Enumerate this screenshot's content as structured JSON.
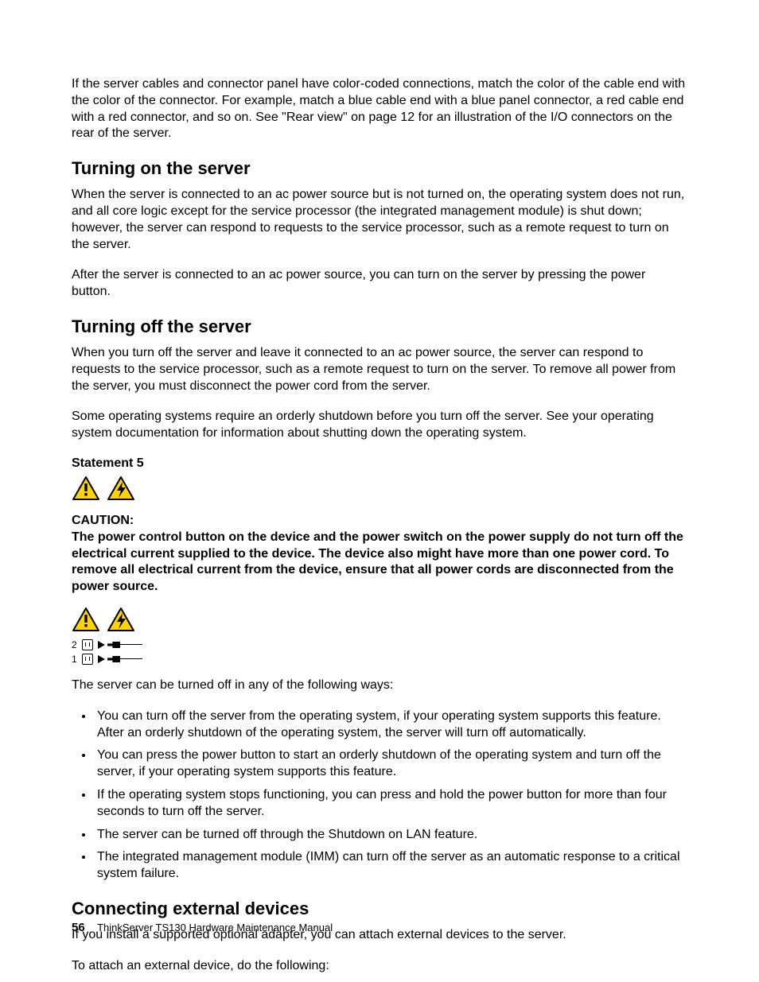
{
  "intro": "If the server cables and connector panel have color-coded connections, match the color of the cable end with the color of the connector. For example, match a blue cable end with a blue panel connector, a red cable end with a red connector, and so on. See \"Rear view\" on page 12 for an illustration of the I/O connectors on the rear of the server.",
  "section1": {
    "title": "Turning on the server",
    "p1": "When the server is connected to an ac power source but is not turned on, the operating system does not run, and all core logic except for the service processor (the integrated management module) is shut down; however, the server can respond to requests to the service processor, such as a remote request to turn on the server.",
    "p2": "After the server is connected to an ac power source, you can turn on the server by pressing the power button."
  },
  "section2": {
    "title": "Turning off the server",
    "p1": "When you turn off the server and leave it connected to an ac power source, the server can respond to requests to the service processor, such as a remote request to turn on the server. To remove all power from the server, you must disconnect the power cord from the server.",
    "p2": "Some operating systems require an orderly shutdown before you turn off the server. See your operating system documentation for information about shutting down the operating system.",
    "statement_label": "Statement 5",
    "caution_label": "CAUTION:",
    "caution_text": "The power control button on the device and the power switch on the power supply do not turn off the electrical current supplied to the device. The device also might have more than one power cord. To remove all electrical current from the device, ensure that all power cords are disconnected from the power source.",
    "plug_rows": {
      "a": "2",
      "b": "1"
    },
    "p3": "The server can be turned off in any of the following ways:",
    "bullets": [
      "You can turn off the server from the operating system, if your operating system supports this feature. After an orderly shutdown of the operating system, the server will turn off automatically.",
      "You can press the power button to start an orderly shutdown of the operating system and turn off the server, if your operating system supports this feature.",
      "If the operating system stops functioning, you can press and hold the power button for more than four seconds to turn off the server.",
      "The server can be turned off through the Shutdown on LAN feature.",
      "The integrated management module (IMM) can turn off the server as an automatic response to a critical system failure."
    ]
  },
  "section3": {
    "title": "Connecting external devices",
    "p1": "If you install a supported optional adapter, you can attach external devices to the server.",
    "p2": "To attach an external device, do the following:"
  },
  "footer": {
    "page": "56",
    "title": "ThinkServer TS130 Hardware Maintenance Manual"
  }
}
